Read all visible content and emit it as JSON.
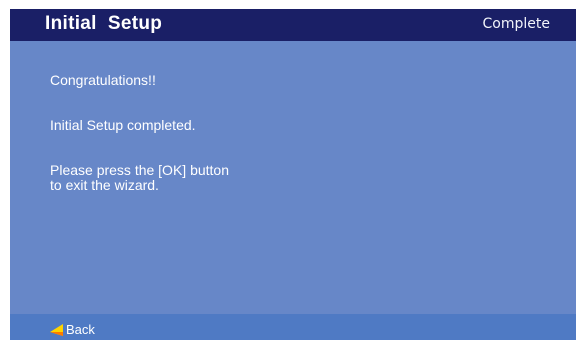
{
  "header": {
    "title": "Initial  Setup",
    "status": "Complete"
  },
  "messages": {
    "congrats": "Congratulations!!",
    "completed": "Initial Setup completed.",
    "instruction_line1": "Please press the [OK] button",
    "instruction_line2": "to exit the wizard."
  },
  "footer": {
    "back_label": "Back",
    "back_icon": "back-arrow-icon"
  },
  "colors": {
    "header_bg": "#1a1f66",
    "body_bg": "#6787c8",
    "footer_bg": "#4f7ac4",
    "back_arrow": "#ffd400"
  }
}
